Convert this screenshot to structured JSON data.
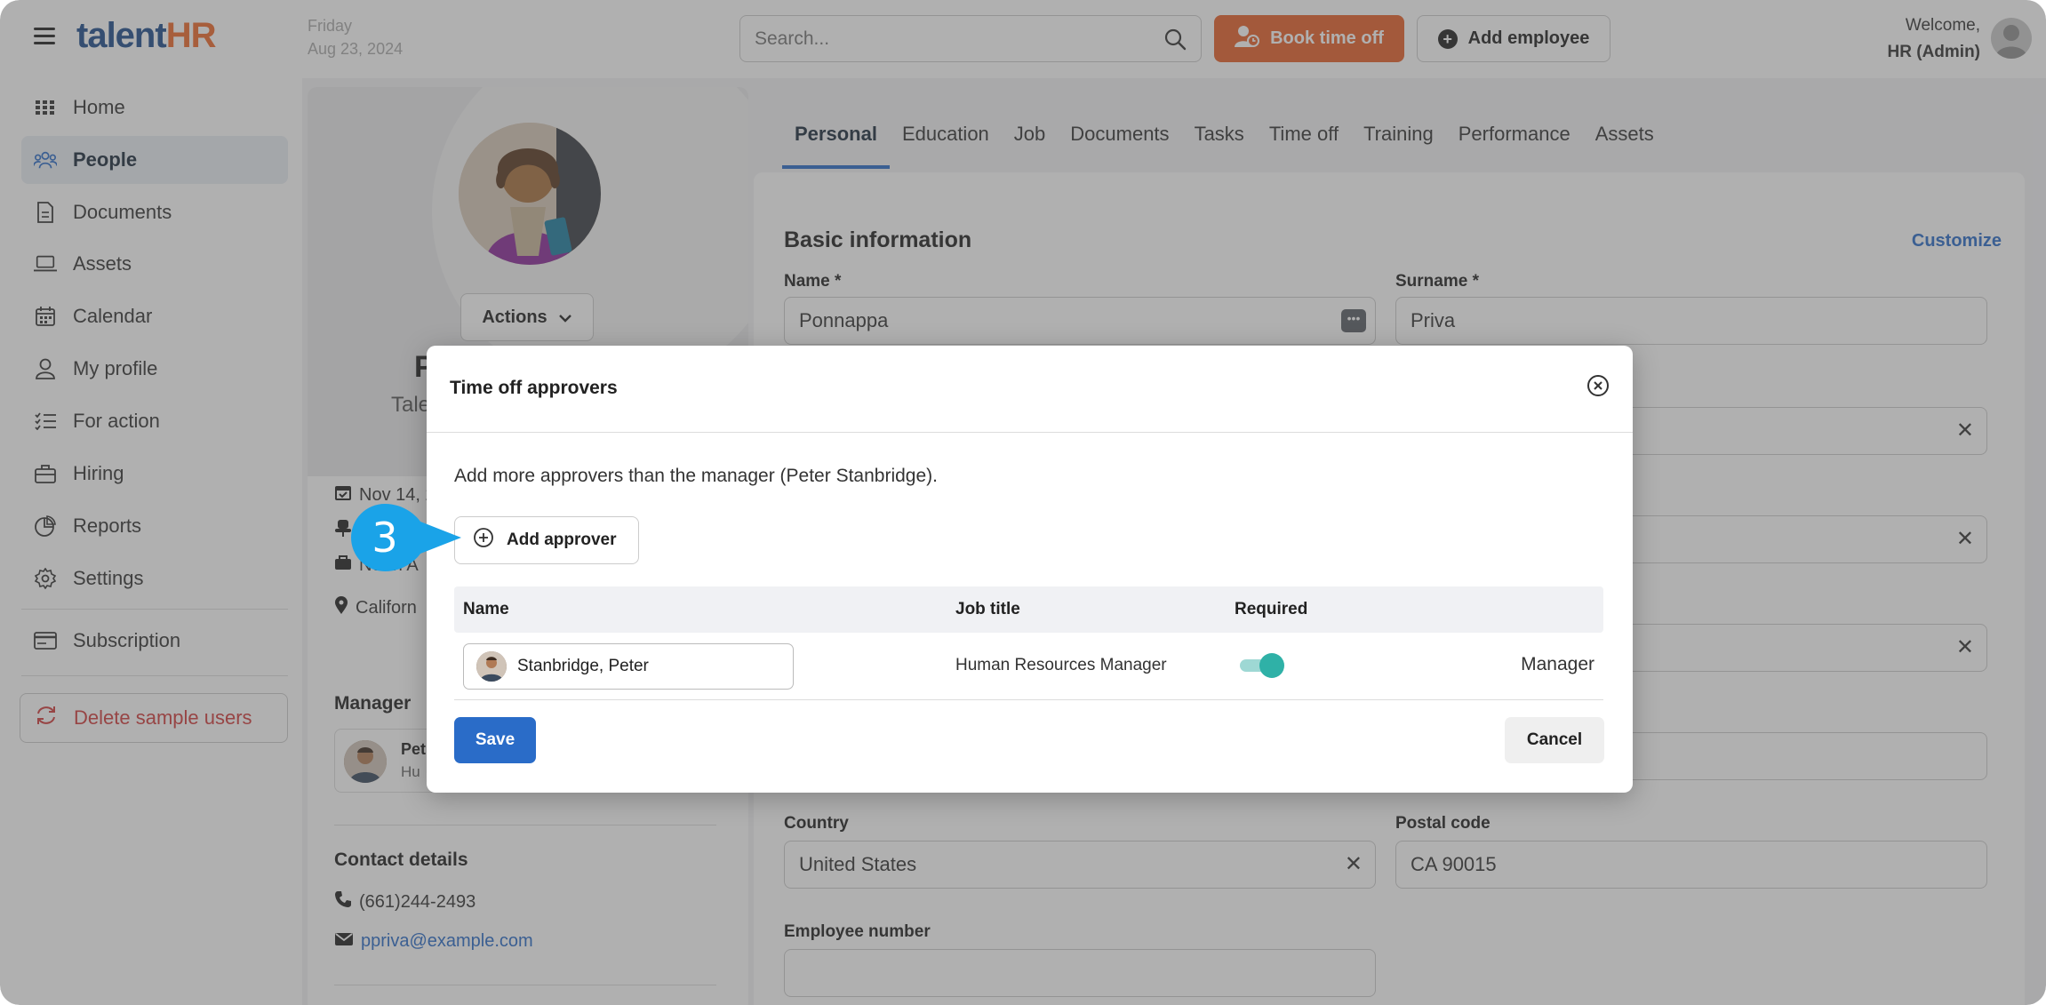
{
  "header": {
    "logo_main": "talent",
    "logo_accent": "HR",
    "date_line1": "Friday",
    "date_line2": "Aug 23, 2024",
    "search_placeholder": "Search...",
    "book_time_off_label": "Book time off",
    "add_employee_label": "Add employee",
    "welcome_label": "Welcome,",
    "user_role": "HR (Admin)"
  },
  "sidebar": {
    "items": [
      {
        "label": "Home",
        "icon": "grid-icon"
      },
      {
        "label": "People",
        "icon": "people-icon",
        "active": true
      },
      {
        "label": "Documents",
        "icon": "document-icon"
      },
      {
        "label": "Assets",
        "icon": "laptop-icon"
      },
      {
        "label": "Calendar",
        "icon": "calendar-icon"
      },
      {
        "label": "My profile",
        "icon": "user-icon"
      },
      {
        "label": "For action",
        "icon": "checklist-icon"
      },
      {
        "label": "Hiring",
        "icon": "briefcase-icon"
      },
      {
        "label": "Reports",
        "icon": "pie-chart-icon"
      },
      {
        "label": "Settings",
        "icon": "gear-icon"
      },
      {
        "label": "Subscription",
        "icon": "card-icon"
      }
    ],
    "delete_label": "Delete sample users"
  },
  "profile": {
    "actions_label": "Actions",
    "name_partial": "P",
    "subtitle_partial": "Tale",
    "start_date_partial": "Nov 14, 2",
    "division_partial": "North A",
    "location_partial": "Californ",
    "manager_title": "Manager",
    "manager_name_partial": "Pet",
    "manager_role_partial": "Hu",
    "contact_title": "Contact details",
    "phone": "(661)244-2493",
    "email": "ppriva@example.com"
  },
  "tabs": [
    "Personal",
    "Education",
    "Job",
    "Documents",
    "Tasks",
    "Time off",
    "Training",
    "Performance",
    "Assets"
  ],
  "form": {
    "section_title": "Basic information",
    "customize_label": "Customize",
    "name_label": "Name *",
    "name_value": "Ponnappa",
    "surname_label": "Surname *",
    "surname_value": "Priva",
    "country_label": "Country",
    "country_value": "United States",
    "postal_label": "Postal code",
    "postal_value": "CA 90015",
    "employee_number_label": "Employee number",
    "employee_number_value": ""
  },
  "modal": {
    "title": "Time off approvers",
    "description": "Add more approvers than the manager (Peter Stanbridge).",
    "add_approver_label": "Add approver",
    "columns": [
      "Name",
      "Job title",
      "Required"
    ],
    "rows": [
      {
        "name": "Stanbridge, Peter",
        "job_title": "Human Resources Manager",
        "required": true,
        "tag": "Manager"
      }
    ],
    "save_label": "Save",
    "cancel_label": "Cancel"
  },
  "callout": {
    "step": "3",
    "color": "#1aa3e8"
  },
  "colors": {
    "brand_blue": "#1f4e8c",
    "brand_orange": "#e8622a",
    "primary_button": "#2a6cc8",
    "toggle_on": "#2fb1a7",
    "delete_red": "#d23c3c"
  }
}
